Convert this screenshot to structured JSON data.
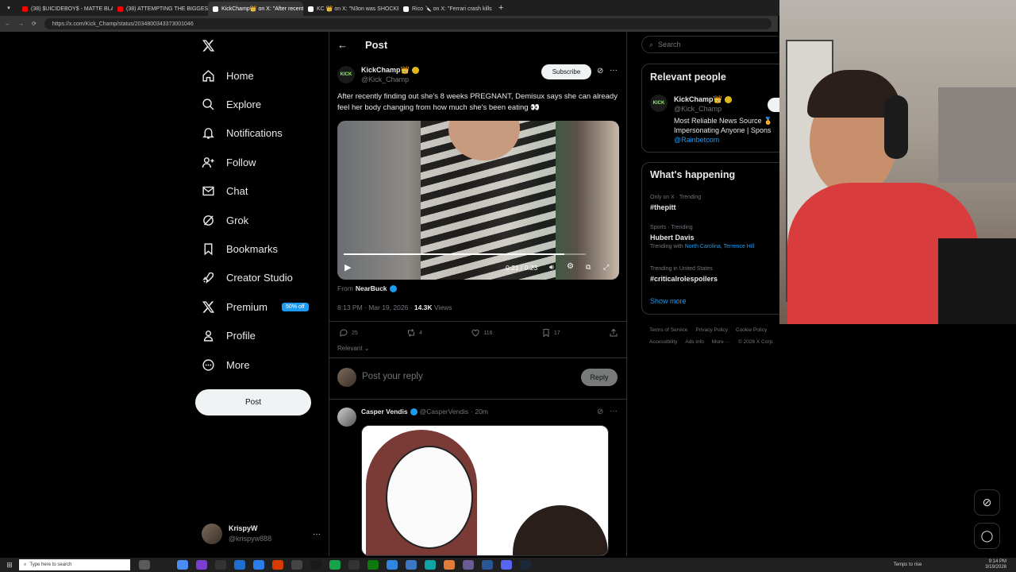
{
  "browser": {
    "tabs": [
      {
        "label": "(38) $UICIDEBOY$ - MATTE BLACK",
        "fav": "#ff0000",
        "active": false
      },
      {
        "label": "(38) ATTEMPTING THE BIGGEST E",
        "fav": "#ff0000",
        "active": false
      },
      {
        "label": "KickChamp👑 on X: \"After recentl",
        "fav": "#ffffff",
        "active": true
      },
      {
        "label": "KC 👑 on X: \"N3on was SHOCKED",
        "fav": "#ffffff",
        "active": false
      },
      {
        "label": "Rico 🔪 on X: \"Ferrari crash kills K",
        "fav": "#ffffff",
        "active": false
      }
    ],
    "url": "https://x.com/Kick_Champ/status/2034800343373001046"
  },
  "nav": {
    "items": [
      {
        "label": "Home",
        "icon": "home-icon"
      },
      {
        "label": "Explore",
        "icon": "search-icon"
      },
      {
        "label": "Notifications",
        "icon": "bell-icon"
      },
      {
        "label": "Follow",
        "icon": "person-add-icon"
      },
      {
        "label": "Chat",
        "icon": "mail-icon"
      },
      {
        "label": "Grok",
        "icon": "grok-icon"
      },
      {
        "label": "Bookmarks",
        "icon": "bookmark-icon"
      },
      {
        "label": "Creator Studio",
        "icon": "rocket-icon"
      },
      {
        "label": "Premium",
        "icon": "x-logo-icon"
      },
      {
        "label": "Profile",
        "icon": "person-icon"
      },
      {
        "label": "More",
        "icon": "more-circle-icon"
      }
    ],
    "premium_badge": "50% off",
    "post_button": "Post",
    "account": {
      "name": "KrispyW",
      "handle": "@krispyw888"
    }
  },
  "post": {
    "header": "Post",
    "author": {
      "name": "KickChamp👑",
      "handle": "@Kick_Champ"
    },
    "subscribe": "Subscribe",
    "text": "After recently finding out she's 8 weeks PREGNANT, Demisux says she can already feel her body changing from how much she's been eating 👀",
    "video_time": "0:21 / 0:23",
    "video_progress": 0.91,
    "from_label": "From",
    "from_user": "NearBuck",
    "meta_time": "8:13 PM · Mar 19, 2026 · ",
    "views_count": "14.3K",
    "views_label": " Views",
    "stats": {
      "replies": "25",
      "reposts": "4",
      "likes": "116",
      "bookmarks": "17"
    },
    "sort": "Relevant",
    "reply_placeholder": "Post your reply",
    "reply_button": "Reply"
  },
  "reply": {
    "name": "Casper Vendis",
    "handle": "@CasperVendis",
    "time": "· 20m"
  },
  "right": {
    "search_placeholder": "Search",
    "relevant": {
      "title": "Relevant people",
      "name": "KickChamp👑",
      "handle": "@Kick_Champ",
      "bio_line1": "Most Reliable News Source 🏅",
      "bio_line2": "Impersonating Anyone | Spons",
      "bio_link": "@Rainbetcom"
    },
    "happening": {
      "title": "What's happening",
      "trends": [
        {
          "context": "Only on X · Trending",
          "name": "#thepitt",
          "extra_prefix": "",
          "extra": ""
        },
        {
          "context": "Sports · Trending",
          "name": "Hubert Davis",
          "extra_prefix": "Trending with ",
          "extra": "North Carolina, Terrence Hill"
        },
        {
          "context": "Trending in United States",
          "name": "#criticalrolespoilers",
          "extra_prefix": "",
          "extra": ""
        }
      ],
      "show_more": "Show more"
    },
    "footer": {
      "row1": [
        "Terms of Service",
        "Privacy Policy",
        "Cookie Policy"
      ],
      "row2": [
        "Accessibility",
        "Ads info",
        "More ···",
        "© 2026 X Corp."
      ]
    }
  },
  "taskbar": {
    "search": "Type here to search",
    "weather": "Temps to rise",
    "time": "9:14 PM",
    "date": "3/19/2026"
  }
}
